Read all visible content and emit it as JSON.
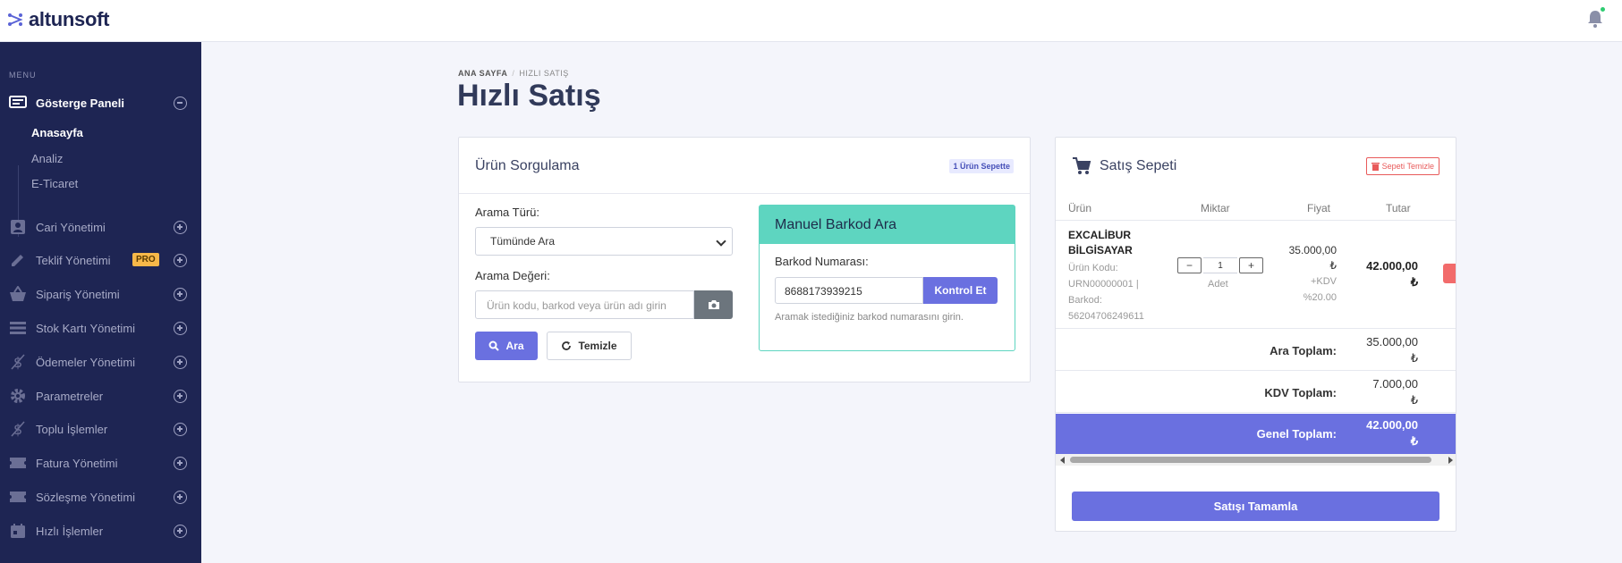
{
  "app": {
    "logo_text": "altunsoft"
  },
  "sidebar": {
    "menu_label": "MENU",
    "items": [
      {
        "label": "Gösterge Paneli",
        "icon": "dashboard-icon",
        "expanded": true
      },
      {
        "label": "Cari Yönetimi",
        "icon": "contacts-icon"
      },
      {
        "label": "Teklif Yönetimi",
        "icon": "pencil-icon",
        "badge": "PRO"
      },
      {
        "label": "Sipariş Yönetimi",
        "icon": "basket-icon"
      },
      {
        "label": "Stok Kartı Yönetimi",
        "icon": "list-icon"
      },
      {
        "label": "Ödemeler Yönetimi",
        "icon": "money-icon"
      },
      {
        "label": "Parametreler",
        "icon": "gear-icon"
      },
      {
        "label": "Toplu İşlemler",
        "icon": "money-icon"
      },
      {
        "label": "Fatura Yönetimi",
        "icon": "ticket-icon"
      },
      {
        "label": "Sözleşme Yönetimi",
        "icon": "ticket-icon"
      },
      {
        "label": "Hızlı İşlemler",
        "icon": "calendar-icon"
      }
    ],
    "sub_items": [
      "Anasayfa",
      "Analiz",
      "E-Ticaret"
    ]
  },
  "breadcrumb": {
    "home": "ANA SAYFA",
    "current": "HIZLI SATIŞ"
  },
  "page_title": "Hızlı Satış",
  "query_card": {
    "title": "Ürün Sorgulama",
    "badge": "1 Ürün Sepette",
    "search_type_label": "Arama Türü:",
    "search_type_value": "Tümünde Ara",
    "search_value_label": "Arama Değeri:",
    "search_placeholder": "Ürün kodu, barkod veya ürün adı girin",
    "search_button": "Ara",
    "clear_button": "Temizle",
    "barcode": {
      "title": "Manuel Barkod Ara",
      "label": "Barkod Numarası:",
      "value": "8688173939215",
      "button": "Kontrol Et",
      "help": "Aramak istediğiniz barkod numarasını girin."
    }
  },
  "cart": {
    "title": "Satış Sepeti",
    "clear_label": "Sepeti Temizle",
    "columns": [
      "Ürün",
      "Miktar",
      "Fiyat",
      "Tutar"
    ],
    "item": {
      "name_line1": "EXCALİBUR",
      "name_line2": "BİLGİSAYAR",
      "meta": [
        "Ürün Kodu:",
        "URN00000001 |",
        "Barkod:",
        "56204706249611"
      ],
      "qty": "1",
      "unit": "Adet",
      "price": "35.000,00",
      "currency": "₺",
      "kdv_line1": "+KDV",
      "kdv_line2": "%20.00",
      "total": "42.000,00"
    },
    "subtotal_label": "Ara Toplam:",
    "subtotal": "35.000,00",
    "kdv_label": "KDV Toplam:",
    "kdv": "7.000,00",
    "grand_label": "Genel Toplam:",
    "grand": "42.000,00",
    "complete_button": "Satışı Tamamla"
  }
}
